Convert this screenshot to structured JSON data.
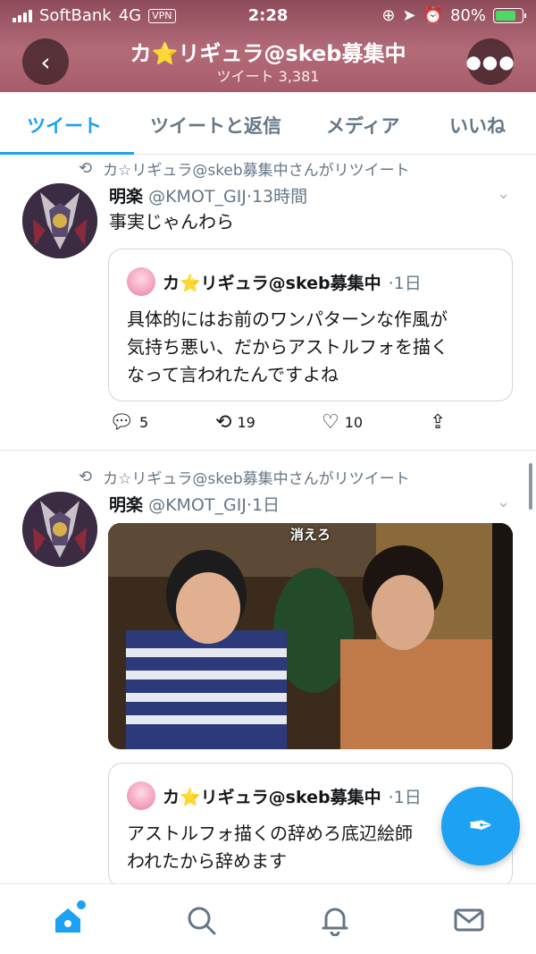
{
  "status_bar": {
    "carrier": "SoftBank",
    "network": "4G",
    "vpn": "VPN",
    "time": "2:28",
    "battery": "80%"
  },
  "header": {
    "title": "カ⭐リギュラ@skeb募集中",
    "subtitle": "ツイート 3,381"
  },
  "tabs": [
    {
      "label": "ツイート",
      "active": true
    },
    {
      "label": "ツイートと返信",
      "active": false
    },
    {
      "label": "メディア",
      "active": false
    },
    {
      "label": "いいね",
      "active": false
    }
  ],
  "tweets": [
    {
      "retweet_label": "カ☆リギュラ@skeb募集中さんがリツイート",
      "name": "明楽",
      "handle": "@KMOT_GIJ",
      "time": "·13時間",
      "text": "事実じゃんわら",
      "quote": {
        "name": "カ⭐リギュラ@skeb募集中",
        "time": "·1日",
        "lines": [
          "具体的にはお前のワンパターンな作風が",
          "気持ち悪い、だからアストルフォを描く",
          "なって言われたんですよね"
        ]
      },
      "replies": "5",
      "retweets": "19",
      "likes": "10"
    },
    {
      "retweet_label": "カ☆リギュラ@skeb募集中さんがリツイート",
      "name": "明楽",
      "handle": "@KMOT_GIJ",
      "time": "·1日",
      "media_caption": "消えろ",
      "quote": {
        "name": "カ⭐リギュラ@skeb募集中",
        "time": "·1日",
        "lines": [
          "アストルフォ描くの辞めろ底辺絵師",
          "われたから辞めます"
        ]
      }
    }
  ],
  "colors": {
    "accent": "#1da1f2",
    "secondary_text": "#657786",
    "header_bg": "#a85c6a"
  },
  "icons": {
    "back": "chevron-left-icon",
    "more": "more-icon",
    "retweet": "retweet-icon",
    "reply": "reply-icon",
    "like": "heart-icon",
    "share": "share-icon",
    "compose": "compose-tweet-icon",
    "home": "home-icon",
    "search": "search-icon",
    "notifications": "bell-icon",
    "messages": "mail-icon"
  }
}
